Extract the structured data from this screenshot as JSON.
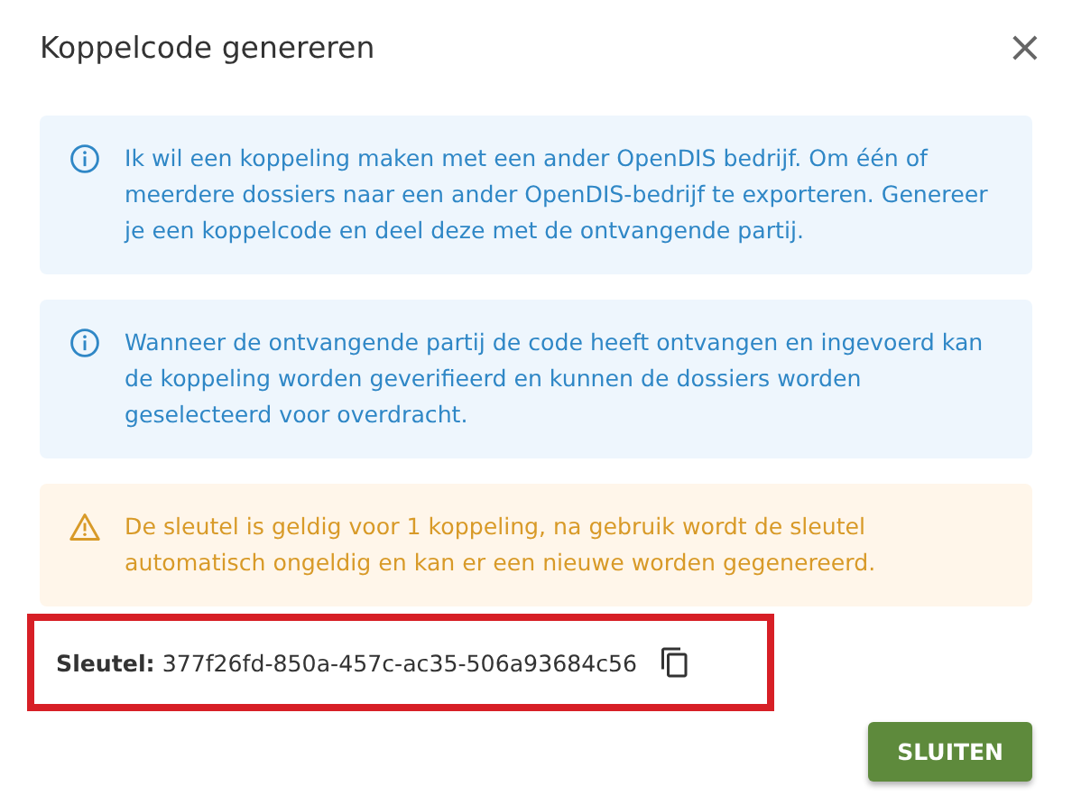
{
  "dialog": {
    "title": "Koppelcode genereren",
    "close": "×"
  },
  "alerts": [
    {
      "kind": "info",
      "text": "Ik wil een koppeling maken met een ander OpenDIS bedrijf. Om één of meerdere dossiers naar een ander OpenDIS-bedrijf te exporteren. Genereer je een koppelcode en deel deze met de ontvangende partij."
    },
    {
      "kind": "info",
      "text": "Wanneer de ontvangende partij de code heeft ontvangen en ingevoerd kan de koppeling worden geverifieerd en kunnen de dossiers worden geselecteerd voor overdracht."
    },
    {
      "kind": "warning",
      "text": "De sleutel is geldig voor 1 koppeling, na gebruik wordt de sleutel automatisch ongeldig en kan er een nieuwe worden gegenereerd."
    }
  ],
  "key": {
    "label": "Sleutel:",
    "value": "377f26fd-850a-457c-ac35-506a93684c56",
    "highlighted": true
  },
  "buttons": [
    {
      "label": "SLUITEN"
    }
  ]
}
